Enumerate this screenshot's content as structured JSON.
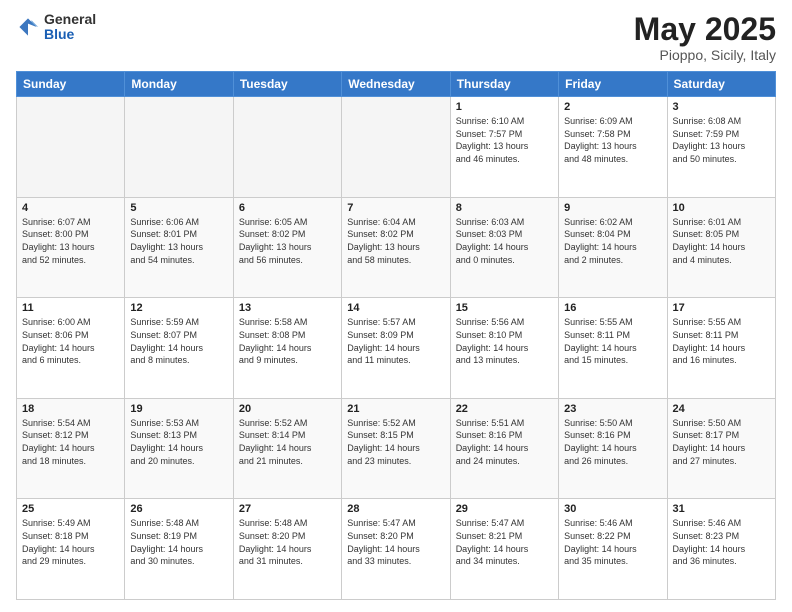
{
  "header": {
    "logo_general": "General",
    "logo_blue": "Blue",
    "title": "May 2025",
    "location": "Pioppo, Sicily, Italy"
  },
  "weekdays": [
    "Sunday",
    "Monday",
    "Tuesday",
    "Wednesday",
    "Thursday",
    "Friday",
    "Saturday"
  ],
  "weeks": [
    [
      {
        "day": "",
        "info": ""
      },
      {
        "day": "",
        "info": ""
      },
      {
        "day": "",
        "info": ""
      },
      {
        "day": "",
        "info": ""
      },
      {
        "day": "1",
        "info": "Sunrise: 6:10 AM\nSunset: 7:57 PM\nDaylight: 13 hours\nand 46 minutes."
      },
      {
        "day": "2",
        "info": "Sunrise: 6:09 AM\nSunset: 7:58 PM\nDaylight: 13 hours\nand 48 minutes."
      },
      {
        "day": "3",
        "info": "Sunrise: 6:08 AM\nSunset: 7:59 PM\nDaylight: 13 hours\nand 50 minutes."
      }
    ],
    [
      {
        "day": "4",
        "info": "Sunrise: 6:07 AM\nSunset: 8:00 PM\nDaylight: 13 hours\nand 52 minutes."
      },
      {
        "day": "5",
        "info": "Sunrise: 6:06 AM\nSunset: 8:01 PM\nDaylight: 13 hours\nand 54 minutes."
      },
      {
        "day": "6",
        "info": "Sunrise: 6:05 AM\nSunset: 8:02 PM\nDaylight: 13 hours\nand 56 minutes."
      },
      {
        "day": "7",
        "info": "Sunrise: 6:04 AM\nSunset: 8:02 PM\nDaylight: 13 hours\nand 58 minutes."
      },
      {
        "day": "8",
        "info": "Sunrise: 6:03 AM\nSunset: 8:03 PM\nDaylight: 14 hours\nand 0 minutes."
      },
      {
        "day": "9",
        "info": "Sunrise: 6:02 AM\nSunset: 8:04 PM\nDaylight: 14 hours\nand 2 minutes."
      },
      {
        "day": "10",
        "info": "Sunrise: 6:01 AM\nSunset: 8:05 PM\nDaylight: 14 hours\nand 4 minutes."
      }
    ],
    [
      {
        "day": "11",
        "info": "Sunrise: 6:00 AM\nSunset: 8:06 PM\nDaylight: 14 hours\nand 6 minutes."
      },
      {
        "day": "12",
        "info": "Sunrise: 5:59 AM\nSunset: 8:07 PM\nDaylight: 14 hours\nand 8 minutes."
      },
      {
        "day": "13",
        "info": "Sunrise: 5:58 AM\nSunset: 8:08 PM\nDaylight: 14 hours\nand 9 minutes."
      },
      {
        "day": "14",
        "info": "Sunrise: 5:57 AM\nSunset: 8:09 PM\nDaylight: 14 hours\nand 11 minutes."
      },
      {
        "day": "15",
        "info": "Sunrise: 5:56 AM\nSunset: 8:10 PM\nDaylight: 14 hours\nand 13 minutes."
      },
      {
        "day": "16",
        "info": "Sunrise: 5:55 AM\nSunset: 8:11 PM\nDaylight: 14 hours\nand 15 minutes."
      },
      {
        "day": "17",
        "info": "Sunrise: 5:55 AM\nSunset: 8:11 PM\nDaylight: 14 hours\nand 16 minutes."
      }
    ],
    [
      {
        "day": "18",
        "info": "Sunrise: 5:54 AM\nSunset: 8:12 PM\nDaylight: 14 hours\nand 18 minutes."
      },
      {
        "day": "19",
        "info": "Sunrise: 5:53 AM\nSunset: 8:13 PM\nDaylight: 14 hours\nand 20 minutes."
      },
      {
        "day": "20",
        "info": "Sunrise: 5:52 AM\nSunset: 8:14 PM\nDaylight: 14 hours\nand 21 minutes."
      },
      {
        "day": "21",
        "info": "Sunrise: 5:52 AM\nSunset: 8:15 PM\nDaylight: 14 hours\nand 23 minutes."
      },
      {
        "day": "22",
        "info": "Sunrise: 5:51 AM\nSunset: 8:16 PM\nDaylight: 14 hours\nand 24 minutes."
      },
      {
        "day": "23",
        "info": "Sunrise: 5:50 AM\nSunset: 8:16 PM\nDaylight: 14 hours\nand 26 minutes."
      },
      {
        "day": "24",
        "info": "Sunrise: 5:50 AM\nSunset: 8:17 PM\nDaylight: 14 hours\nand 27 minutes."
      }
    ],
    [
      {
        "day": "25",
        "info": "Sunrise: 5:49 AM\nSunset: 8:18 PM\nDaylight: 14 hours\nand 29 minutes."
      },
      {
        "day": "26",
        "info": "Sunrise: 5:48 AM\nSunset: 8:19 PM\nDaylight: 14 hours\nand 30 minutes."
      },
      {
        "day": "27",
        "info": "Sunrise: 5:48 AM\nSunset: 8:20 PM\nDaylight: 14 hours\nand 31 minutes."
      },
      {
        "day": "28",
        "info": "Sunrise: 5:47 AM\nSunset: 8:20 PM\nDaylight: 14 hours\nand 33 minutes."
      },
      {
        "day": "29",
        "info": "Sunrise: 5:47 AM\nSunset: 8:21 PM\nDaylight: 14 hours\nand 34 minutes."
      },
      {
        "day": "30",
        "info": "Sunrise: 5:46 AM\nSunset: 8:22 PM\nDaylight: 14 hours\nand 35 minutes."
      },
      {
        "day": "31",
        "info": "Sunrise: 5:46 AM\nSunset: 8:23 PM\nDaylight: 14 hours\nand 36 minutes."
      }
    ]
  ]
}
